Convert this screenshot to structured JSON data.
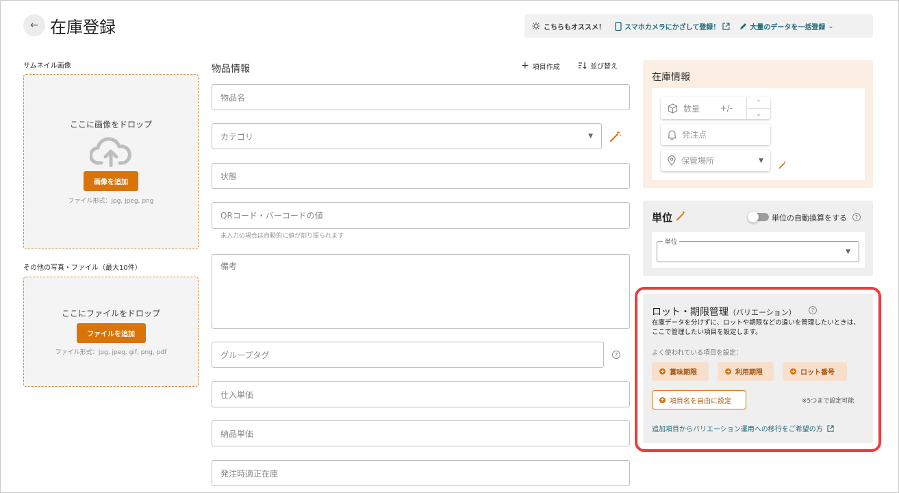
{
  "header": {
    "back_icon": "arrow-left-icon",
    "title": "在庫登録",
    "recommend_label": "こちらもオススメ！",
    "camera_link": "スマホカメラにかざして登録！",
    "bulk_link": "大量のデータを一括登録"
  },
  "left": {
    "thumbnail_label": "サムネイル画像",
    "thumb_drop_text": "ここに画像をドロップ",
    "thumb_button": "画像を追加",
    "thumb_hint": "ファイル形式：jpg, jpeg, png",
    "files_label": "その他の写真・ファイル（最大10件）",
    "files_drop_text": "ここにファイルをドロップ",
    "files_button": "ファイルを追加",
    "files_hint": "ファイル形式：jpg, jpeg, gif, png, pdf"
  },
  "item_info": {
    "title": "物品情報",
    "add_field": "項目作成",
    "sort": "並び替え",
    "fields": {
      "name": "物品名",
      "category": "カテゴリ",
      "condition": "状態",
      "qr": "QRコード・バーコードの値",
      "qr_helper": "未入力の場合は自動的に値が割り振られます",
      "note": "備考",
      "group_tag": "グループタグ",
      "purchase_price": "仕入単価",
      "delivery_price": "納品単価",
      "reorder_stock": "発注時適正在庫"
    }
  },
  "stock": {
    "title": "在庫情報",
    "quantity": "数量",
    "quantity_op": "+/-",
    "reorder_point": "発注点",
    "location": "保管場所"
  },
  "unit": {
    "title": "単位",
    "auto_convert": "単位の自動換算をする",
    "field_legend": "単位"
  },
  "lot": {
    "title": "ロット・期限管理",
    "title_sub": "（バリエーション）",
    "description": "在庫データを分けずに、ロットや期限などの違いを管理したいときは、ここで管理したい項目を設定します。",
    "common_label": "よく使われている項目を設定：",
    "chips": [
      "賞味期限",
      "利用期限",
      "ロット番号"
    ],
    "custom_chip": "項目名を自由に設定",
    "limit_note": "※5つまで設定可能",
    "migration_link": "追加項目からバリエーション運用への移行をご希望の方"
  },
  "colors": {
    "accent": "#d9740b",
    "teal": "#1e6a78",
    "highlight": "#ef3b3b"
  }
}
